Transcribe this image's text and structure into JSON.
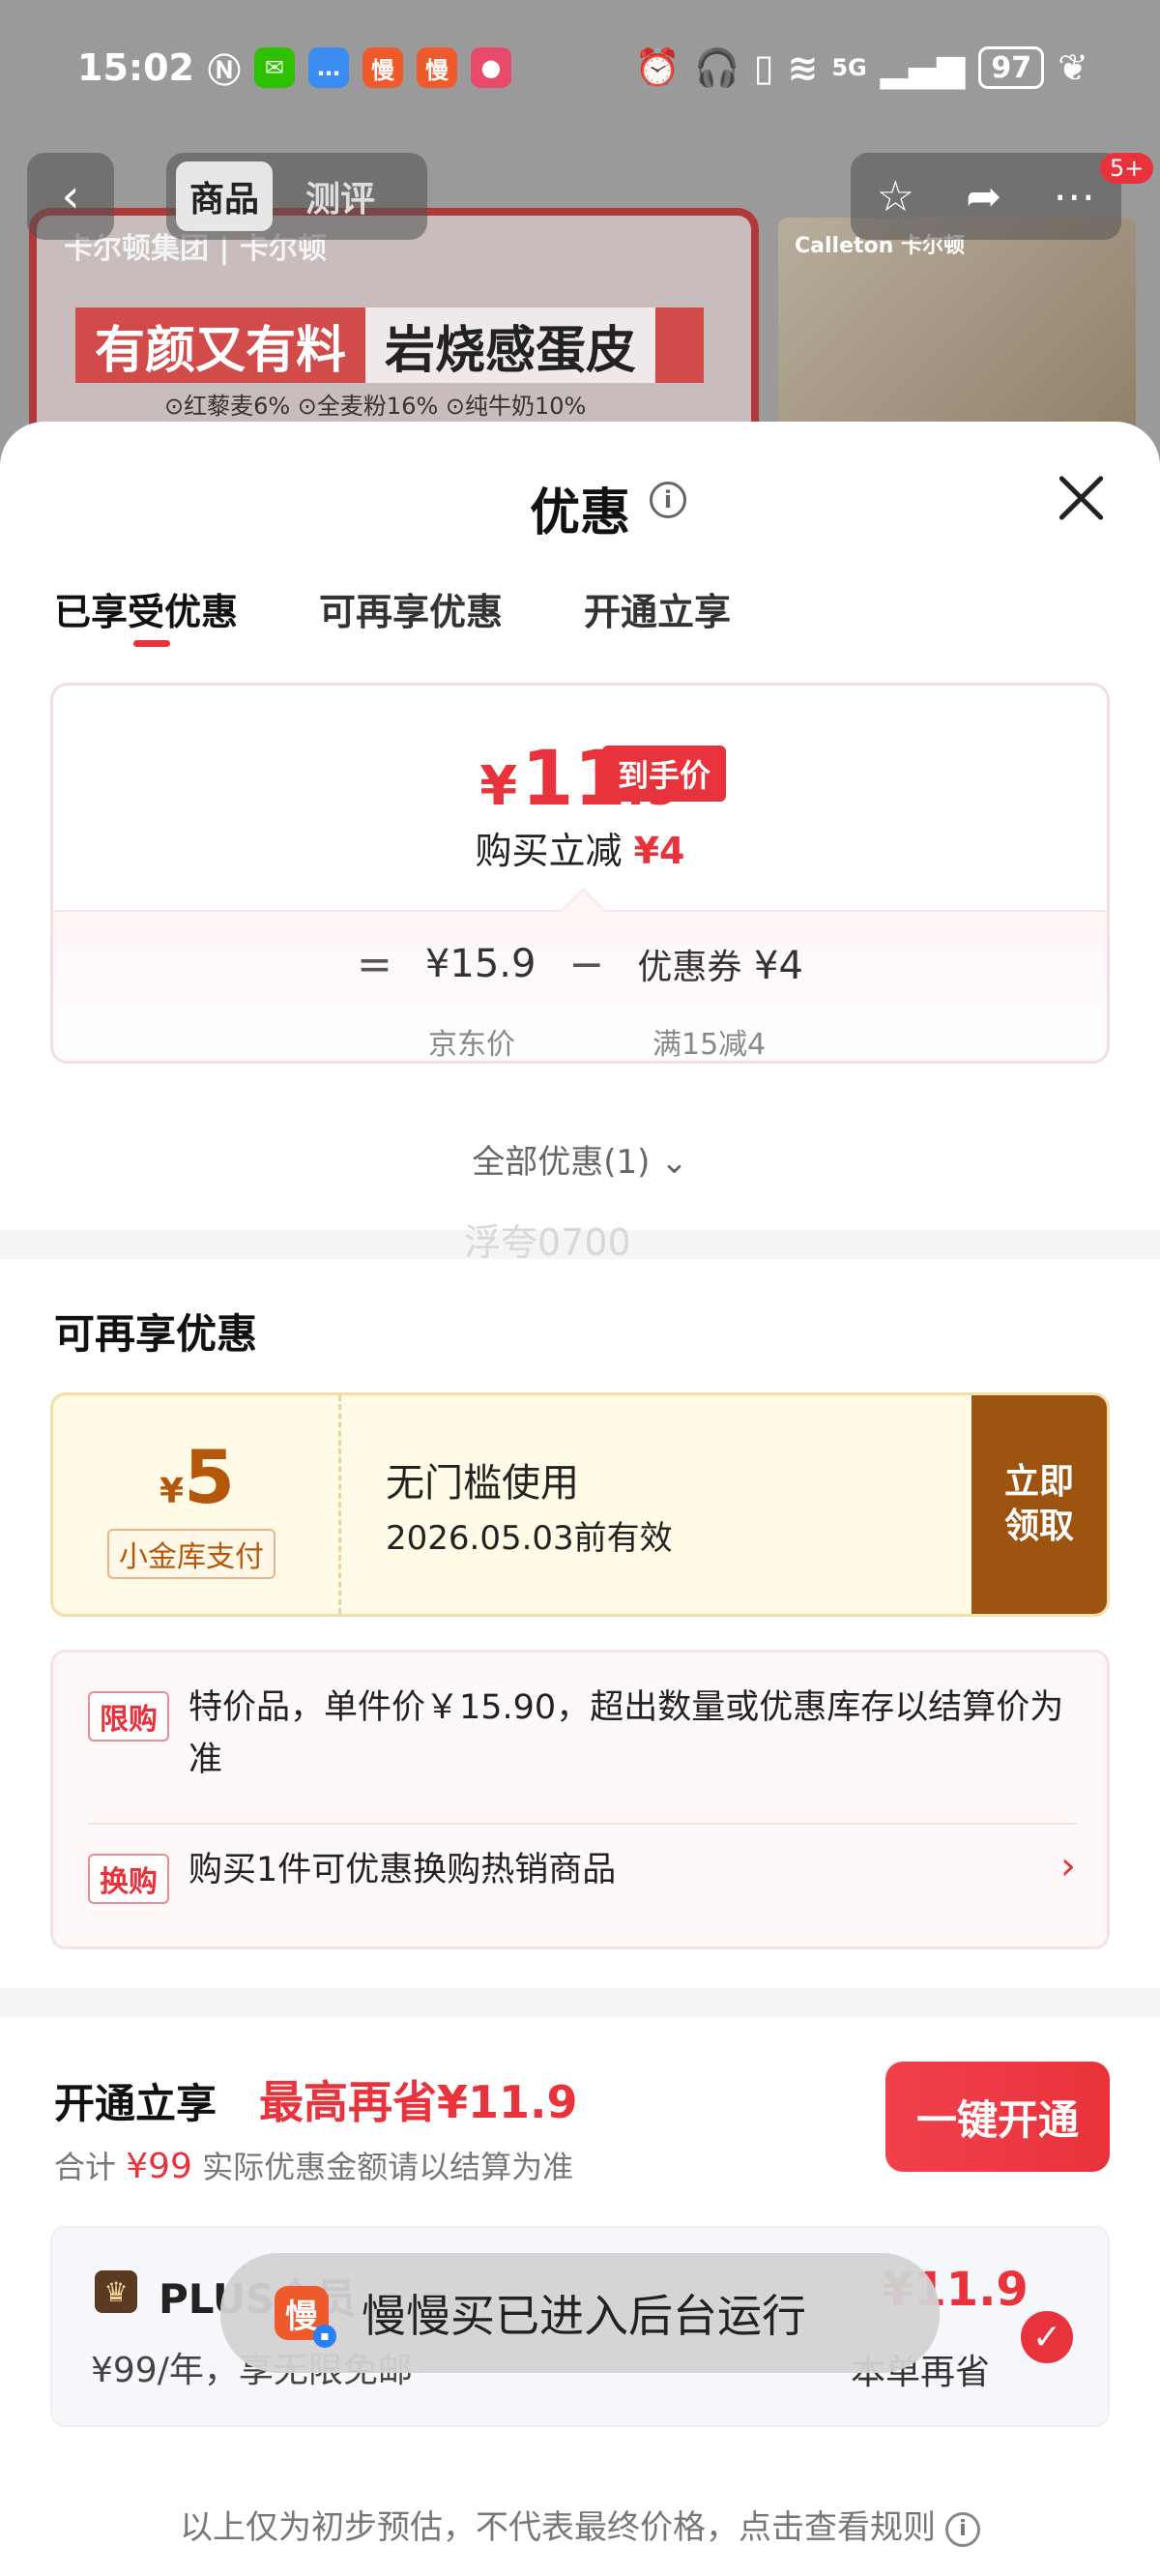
{
  "status_bar": {
    "time": "15:02",
    "battery": "97",
    "network": "5G",
    "app_icons": [
      "慢",
      "慢"
    ]
  },
  "nav": {
    "back_icon": "chevron-left-icon",
    "tabs": [
      {
        "label": "商品"
      },
      {
        "label": "测评"
      }
    ],
    "badge": "5+"
  },
  "banner": {
    "brand": "卡尔顿集团 | 卡尔顿",
    "slogan_left": "有颜又有料",
    "slogan_right": "岩烧感蛋皮",
    "features": "⊙红藜麦6% ⊙全麦粉16% ⊙纯牛奶10%",
    "photo_brand": "Calleton 卡尔顿"
  },
  "sheet": {
    "title": "优惠",
    "tabs": [
      {
        "label": "已享受优惠"
      },
      {
        "label": "可再享优惠"
      },
      {
        "label": "开通立享"
      }
    ]
  },
  "price": {
    "currency": "¥",
    "integer": "11",
    "decimal": ".9",
    "tag": "到手价",
    "reduce_label": "购买立减",
    "reduce_amount": "¥4",
    "eq": "=",
    "jd_price": "¥15.9",
    "minus": "−",
    "coupon_label": "优惠券",
    "coupon_amount": "¥4",
    "jd_label": "京东价",
    "coupon_rule": "满15减4"
  },
  "all_offers": "全部优惠(1)",
  "watermark": "浮夸0700",
  "section_more": {
    "title": "可再享优惠",
    "coupon": {
      "yen": "¥",
      "amount": "5",
      "type": "小金库支付",
      "title": "无门槛使用",
      "valid": "2026.05.03前有效",
      "button": "立即\n领取"
    },
    "rules": [
      {
        "tag": "限购",
        "text": "特价品，单件价￥15.90，超出数量或优惠库存以结算价为准"
      },
      {
        "tag": "换购",
        "text": "购买1件可优惠换购热销商品"
      }
    ]
  },
  "section_plus": {
    "title": "开通立享",
    "highlight": "最高再省¥11.9",
    "sub_prefix": "合计",
    "sub_amount": "¥99",
    "sub_suffix": "实际优惠金额请以结算为准",
    "button": "一键开通",
    "card": {
      "name": "PLUS会员",
      "price": "¥99/年，享无限免邮",
      "save_amount": "¥11.9",
      "save_label": "本单再省"
    }
  },
  "toast": {
    "app_label": "慢",
    "text": "慢慢买已进入后台运行"
  },
  "disclaimer": "以上仅为初步预估，不代表最终价格，点击查看规则"
}
